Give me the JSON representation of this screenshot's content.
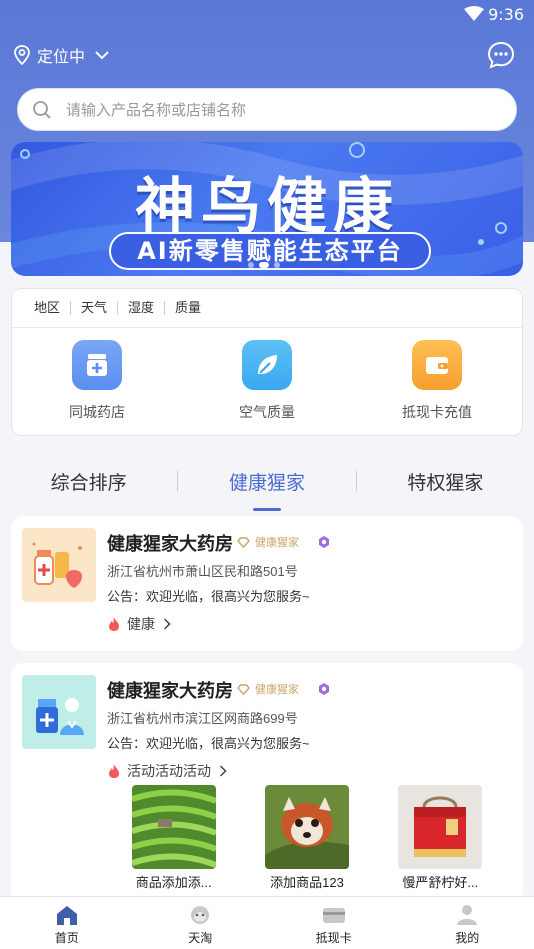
{
  "status": {
    "time": "9:36"
  },
  "header": {
    "location_label": "定位中",
    "search_placeholder": "请输入产品名称或店铺名称"
  },
  "banner": {
    "title": "神鸟健康",
    "subtitle": "AI新零售赋能生态平台"
  },
  "quick_tabs": [
    "地区",
    "天气",
    "湿度",
    "质量"
  ],
  "quick_items": [
    {
      "label": "同城药店",
      "icon": "pharmacy-icon",
      "color": "#5b8ef0"
    },
    {
      "label": "空气质量",
      "icon": "leaf-icon",
      "color": "#3aa8f0"
    },
    {
      "label": "抵现卡充值",
      "icon": "wallet-icon",
      "color": "#f5a030"
    }
  ],
  "sort_tabs": [
    "综合排序",
    "健康猩家",
    "特权猩家"
  ],
  "shops": [
    {
      "name": "健康猩家大药房",
      "tag": "健康猩家",
      "address": "浙江省杭州市萧山区民和路501号",
      "notice": "公告：欢迎光临，很高兴为您服务~",
      "category": "健康"
    },
    {
      "name": "健康猩家大药房",
      "tag": "健康猩家",
      "address": "浙江省杭州市滨江区网商路699号",
      "notice": "公告：欢迎光临，很高兴为您服务~",
      "category": "活动活动活动",
      "products": [
        {
          "name": "商品添加添..."
        },
        {
          "name": "添加商品123"
        },
        {
          "name": "慢严舒柠好..."
        }
      ]
    }
  ],
  "tabbar": [
    "首页",
    "天淘",
    "抵现卡",
    "我的"
  ],
  "colors": {
    "primary": "#4a6cd0",
    "header_bg": "#5a78d6",
    "gold": "#c9a66b",
    "flame": "#f05a5a"
  }
}
